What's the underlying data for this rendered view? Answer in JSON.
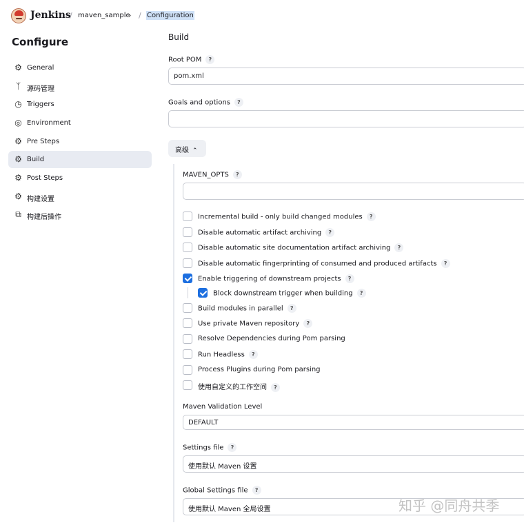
{
  "header": {
    "brand": "Jenkins",
    "breadcrumb": [
      "maven_sample",
      "Configuration"
    ],
    "separator": "/"
  },
  "sidebar": {
    "title": "Configure",
    "items": [
      {
        "label": "General",
        "icon": "gear-icon"
      },
      {
        "label": "源码管理",
        "icon": "branch-icon"
      },
      {
        "label": "Triggers",
        "icon": "clock-icon"
      },
      {
        "label": "Environment",
        "icon": "globe-icon"
      },
      {
        "label": "Pre Steps",
        "icon": "gear-icon"
      },
      {
        "label": "Build",
        "icon": "gear-icon",
        "active": true
      },
      {
        "label": "Post Steps",
        "icon": "gear-icon"
      },
      {
        "label": "构建设置",
        "icon": "gear-icon"
      },
      {
        "label": "构建后操作",
        "icon": "box-icon"
      }
    ]
  },
  "main": {
    "section_title": "Build",
    "root_pom": {
      "label": "Root POM",
      "value": "pom.xml"
    },
    "goals": {
      "label": "Goals and options",
      "value": ""
    },
    "advanced_button": "高级",
    "maven_opts": {
      "label": "MAVEN_OPTS",
      "value": ""
    },
    "checkboxes": [
      {
        "label": "Incremental build - only build changed modules",
        "checked": false,
        "help": true
      },
      {
        "label": "Disable automatic artifact archiving",
        "checked": false,
        "help": true
      },
      {
        "label": "Disable automatic site documentation artifact archiving",
        "checked": false,
        "help": true
      },
      {
        "label": "Disable automatic fingerprinting of consumed and produced artifacts",
        "checked": false,
        "help": true
      },
      {
        "label": "Enable triggering of downstream projects",
        "checked": true,
        "help": true
      },
      {
        "label": "Block downstream trigger when building",
        "checked": true,
        "help": true,
        "nested": true
      },
      {
        "label": "Build modules in parallel",
        "checked": false,
        "help": true
      },
      {
        "label": "Use private Maven repository",
        "checked": false,
        "help": true
      },
      {
        "label": "Resolve Dependencies during Pom parsing",
        "checked": false,
        "help": false
      },
      {
        "label": "Run Headless",
        "checked": false,
        "help": true
      },
      {
        "label": "Process Plugins during Pom parsing",
        "checked": false,
        "help": false
      },
      {
        "label": "使用自定义的工作空间",
        "checked": false,
        "help": true
      }
    ],
    "validation_level": {
      "label": "Maven Validation Level",
      "value": "DEFAULT"
    },
    "settings_file": {
      "label": "Settings file",
      "value": "使用默认 Maven 设置"
    },
    "global_settings_file": {
      "label": "Global Settings file",
      "value": "使用默认 Maven 全局设置"
    }
  },
  "help_glyph": "?",
  "watermark": "知乎 @同舟共季",
  "colors": {
    "accent": "#1d6fe0",
    "active_nav": "#e8ebf2",
    "selection": "#cfe1f7"
  }
}
